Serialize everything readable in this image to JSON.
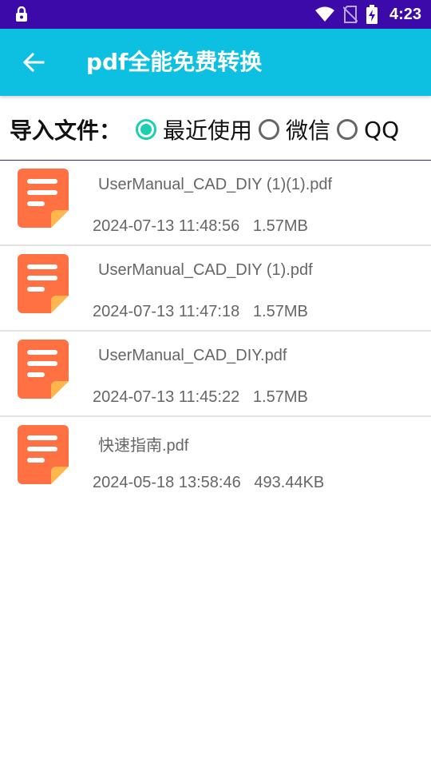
{
  "status_bar": {
    "time": "4:23",
    "icons": [
      "lock-icon",
      "wifi-icon",
      "no-sim-icon",
      "battery-charging-icon"
    ]
  },
  "app_bar": {
    "title": "pdf全能免费转换",
    "back_icon": "arrow-back-icon"
  },
  "import": {
    "label": "导入文件：",
    "options": [
      {
        "label": "最近使用",
        "checked": true
      },
      {
        "label": "微信",
        "checked": false
      },
      {
        "label": "QQ",
        "checked": false
      }
    ]
  },
  "files": [
    {
      "name": "UserManual_CAD_DIY (1)(1).pdf",
      "date": "2024-07-13 11:48:56",
      "size": "1.57MB"
    },
    {
      "name": "UserManual_CAD_DIY (1).pdf",
      "date": "2024-07-13 11:47:18",
      "size": "1.57MB"
    },
    {
      "name": "UserManual_CAD_DIY.pdf",
      "date": "2024-07-13 11:45:22",
      "size": "1.57MB"
    },
    {
      "name": "快速指南.pdf",
      "date": "2024-05-18 13:58:46",
      "size": "493.44KB"
    }
  ],
  "colors": {
    "status_bar": "#3b0aa8",
    "app_bar": "#0dbfe0",
    "accent": "#1ccfb0",
    "file_icon": "#ff7043",
    "file_icon_fold": "#ffb74d"
  }
}
